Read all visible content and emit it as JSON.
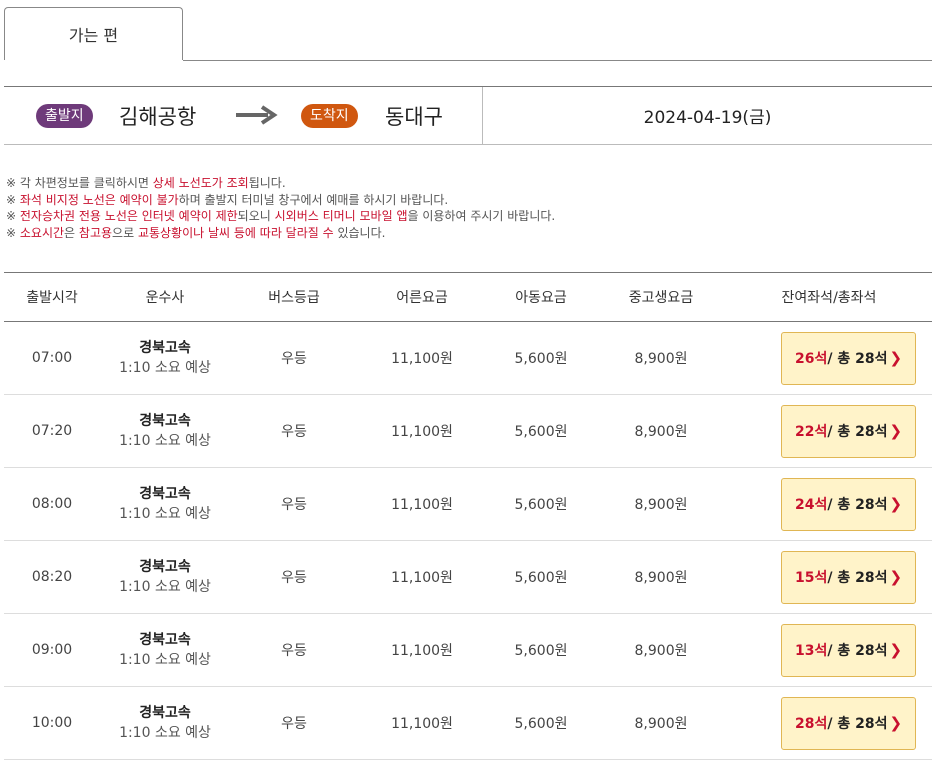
{
  "tab": {
    "label": "가는 편"
  },
  "route": {
    "depart_badge": "출발지",
    "depart_place": "김해공항",
    "arrive_badge": "도착지",
    "arrive_place": "동대구",
    "date": "2024-04-19(금)"
  },
  "notices": [
    [
      {
        "t": "※ 각 차편정보를 클릭하시면 "
      },
      {
        "t": "상세 노선도가 조회",
        "hl": true
      },
      {
        "t": "됩니다."
      }
    ],
    [
      {
        "t": "※ "
      },
      {
        "t": "좌석 비지정 노선은 예약이 불가",
        "hl": true
      },
      {
        "t": "하며 출발지 터미널 창구에서 예매를 하시기 바랍니다."
      }
    ],
    [
      {
        "t": "※ "
      },
      {
        "t": "전자승차권 전용 노선은 인터넷 예약이 제한",
        "hl": true
      },
      {
        "t": "되오니 "
      },
      {
        "t": "시외버스 티머니 모바일 앱",
        "hl": true
      },
      {
        "t": "을 이용하여 주시기 바랍니다."
      }
    ],
    [
      {
        "t": "※ "
      },
      {
        "t": "소요시간",
        "hl": true
      },
      {
        "t": "은 "
      },
      {
        "t": "참고용",
        "hl": true
      },
      {
        "t": "으로 "
      },
      {
        "t": "교통상황이나 날씨 등에 따라 달라질 수",
        "hl": true
      },
      {
        "t": " 있습니다."
      }
    ]
  ],
  "table": {
    "headers": [
      "출발시각",
      "운수사",
      "버스등급",
      "어른요금",
      "아동요금",
      "중고생요금",
      "잔여좌석/총좌석"
    ],
    "rows": [
      {
        "time": "07:00",
        "company": "경북고속",
        "duration": "1:10 소요 예상",
        "grade": "우등",
        "adult": "11,100원",
        "child": "5,600원",
        "youth": "8,900원",
        "remain": "26석",
        "total": " / 총 28석"
      },
      {
        "time": "07:20",
        "company": "경북고속",
        "duration": "1:10 소요 예상",
        "grade": "우등",
        "adult": "11,100원",
        "child": "5,600원",
        "youth": "8,900원",
        "remain": "22석",
        "total": " / 총 28석"
      },
      {
        "time": "08:00",
        "company": "경북고속",
        "duration": "1:10 소요 예상",
        "grade": "우등",
        "adult": "11,100원",
        "child": "5,600원",
        "youth": "8,900원",
        "remain": "24석",
        "total": " / 총 28석"
      },
      {
        "time": "08:20",
        "company": "경북고속",
        "duration": "1:10 소요 예상",
        "grade": "우등",
        "adult": "11,100원",
        "child": "5,600원",
        "youth": "8,900원",
        "remain": "15석",
        "total": " / 총 28석"
      },
      {
        "time": "09:00",
        "company": "경북고속",
        "duration": "1:10 소요 예상",
        "grade": "우등",
        "adult": "11,100원",
        "child": "5,600원",
        "youth": "8,900원",
        "remain": "13석",
        "total": " / 총 28석"
      },
      {
        "time": "10:00",
        "company": "경북고속",
        "duration": "1:10 소요 예상",
        "grade": "우등",
        "adult": "11,100원",
        "child": "5,600원",
        "youth": "8,900원",
        "remain": "28석",
        "total": " / 총 28석"
      }
    ]
  },
  "icons": {
    "route_arrow": "arrow-right-icon",
    "seat_chevron": "chevron-right-icon"
  },
  "colors": {
    "depart_badge": "#6e3a7a",
    "arrive_badge": "#d0570f",
    "highlight": "#c8102e",
    "seat_button_bg": "#fff3c9",
    "seat_button_border": "#e0b654"
  }
}
